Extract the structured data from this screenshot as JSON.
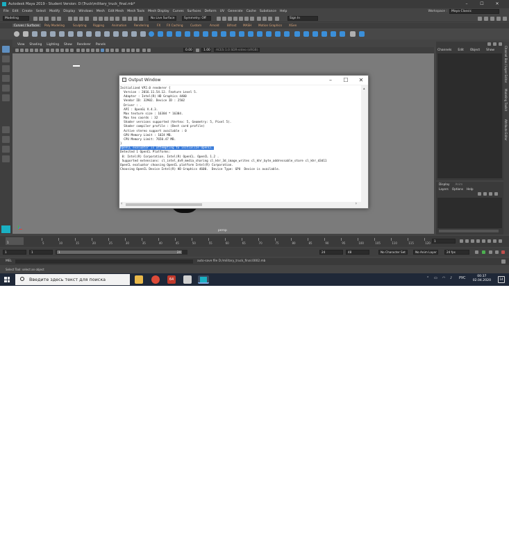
{
  "app": {
    "title": "Autodesk Maya 2019 - Student Version: D:\\Truck\\military_truck_final.mb*",
    "menus": [
      "File",
      "Edit",
      "Create",
      "Select",
      "Modify",
      "Display",
      "Windows",
      "Mesh",
      "Edit Mesh",
      "Mesh Tools",
      "Mesh Display",
      "Curves",
      "Surfaces",
      "Deform",
      "UV",
      "Generate",
      "Cache",
      "Substance",
      "Help"
    ],
    "workspace_label": "Workspace :",
    "workspace_value": "Maya Classic",
    "window_controls": [
      "–",
      "☐",
      "✕"
    ]
  },
  "statusline": {
    "mode": "Modeling",
    "live_surface": "No Live Surface",
    "symmetry": "Symmetry: Off",
    "sign_in": "Sign In"
  },
  "shelf": {
    "tabs": [
      "Curves / Surfaces",
      "Poly Modeling",
      "Sculpting",
      "Rigging",
      "Animation",
      "Rendering",
      "FX",
      "FX Caching",
      "Custom",
      "Arnold",
      "Bifrost",
      "MASH",
      "Motion Graphics",
      "XGen"
    ],
    "active_tab": 0
  },
  "viewport": {
    "menus": [
      "View",
      "Shading",
      "Lighting",
      "Show",
      "Renderer",
      "Panels"
    ],
    "near": "0.00",
    "far": "1.00",
    "colorspace": "ACES 1.0 SDR-video (sRGB)",
    "camera_label": "persp"
  },
  "channel_box": {
    "tabs": [
      "Channels",
      "Edit",
      "Object",
      "Show"
    ]
  },
  "layer_editor": {
    "tabs": [
      "Display",
      "Anim"
    ],
    "menus": [
      "Layers",
      "Options",
      "Help"
    ]
  },
  "side_tabs": [
    "Channel Box / Layer Editor",
    "Modeling Toolkit",
    "Attribute Editor"
  ],
  "timeline": {
    "ticks": [
      "5",
      "10",
      "15",
      "20",
      "25",
      "30",
      "35",
      "40",
      "45",
      "50",
      "55",
      "60",
      "65",
      "70",
      "75",
      "80",
      "85",
      "90",
      "95",
      "100",
      "105",
      "110",
      "115",
      "120"
    ],
    "current_frame": "1",
    "range_start": "1",
    "range_inner_start": "1",
    "range_inner_end": "24",
    "range_end": "24",
    "anim_end": "48",
    "character_set": "No Character Set",
    "anim_layer": "No Anim Layer",
    "fps": "24 fps"
  },
  "command_line": {
    "label": "MEL",
    "result": "auto-save file D:/military_truck_final.0002.mb",
    "help": "Select Tool: select an object"
  },
  "output_window": {
    "title": "Output Window",
    "lines": [
      "Initialized VP2.0 renderer {",
      "  Version : 2016.11.54.12. Feature Level 5.",
      "  Adapter : Intel(R) HD Graphics 4400",
      "  Vendor ID: 32902. Device ID : 2502",
      "  Driver : .",
      "  API : OpenGL V.4.3.",
      "  Max texture size : 16384 * 16384.",
      "  Max tex coords : 32",
      "  Shader versions supported (Vertex: 5, Geometry: 5, Pixel 5).",
      "  Shader compiler profile : (Best card profile)",
      "  Active stereo support available : 0",
      "  GPU Memory Limit : 1024 MB.",
      "  CPU Memory Limit: 7650.47 MB.",
      "}",
      "OpenCL evaluator is attempting to initialize OpenCL.",
      "Detected 1 OpenCL Platforms:",
      " 0: Intel(R) Corporation. Intel(R) OpenCL. OpenCL 1.2 .",
      " Supported extensions: cl_intel_dx9_media_sharing cl_khr_3d_image_writes cl_khr_byte_addressable_store cl_khr_d3d11",
      "OpenCL evaluator choosing OpenCL platform Intel(R) Corporation.",
      "Choosing OpenCL Device Intel(R) HD Graphics 4600.  Device Type: GPU  Device is available."
    ],
    "selected_line": 14
  },
  "taskbar": {
    "search_placeholder": "Введите здесь текст для поиска",
    "language": "РУС",
    "time": "00:37",
    "date": "02.04.2020",
    "notifications": "14",
    "app_badge": "64"
  }
}
